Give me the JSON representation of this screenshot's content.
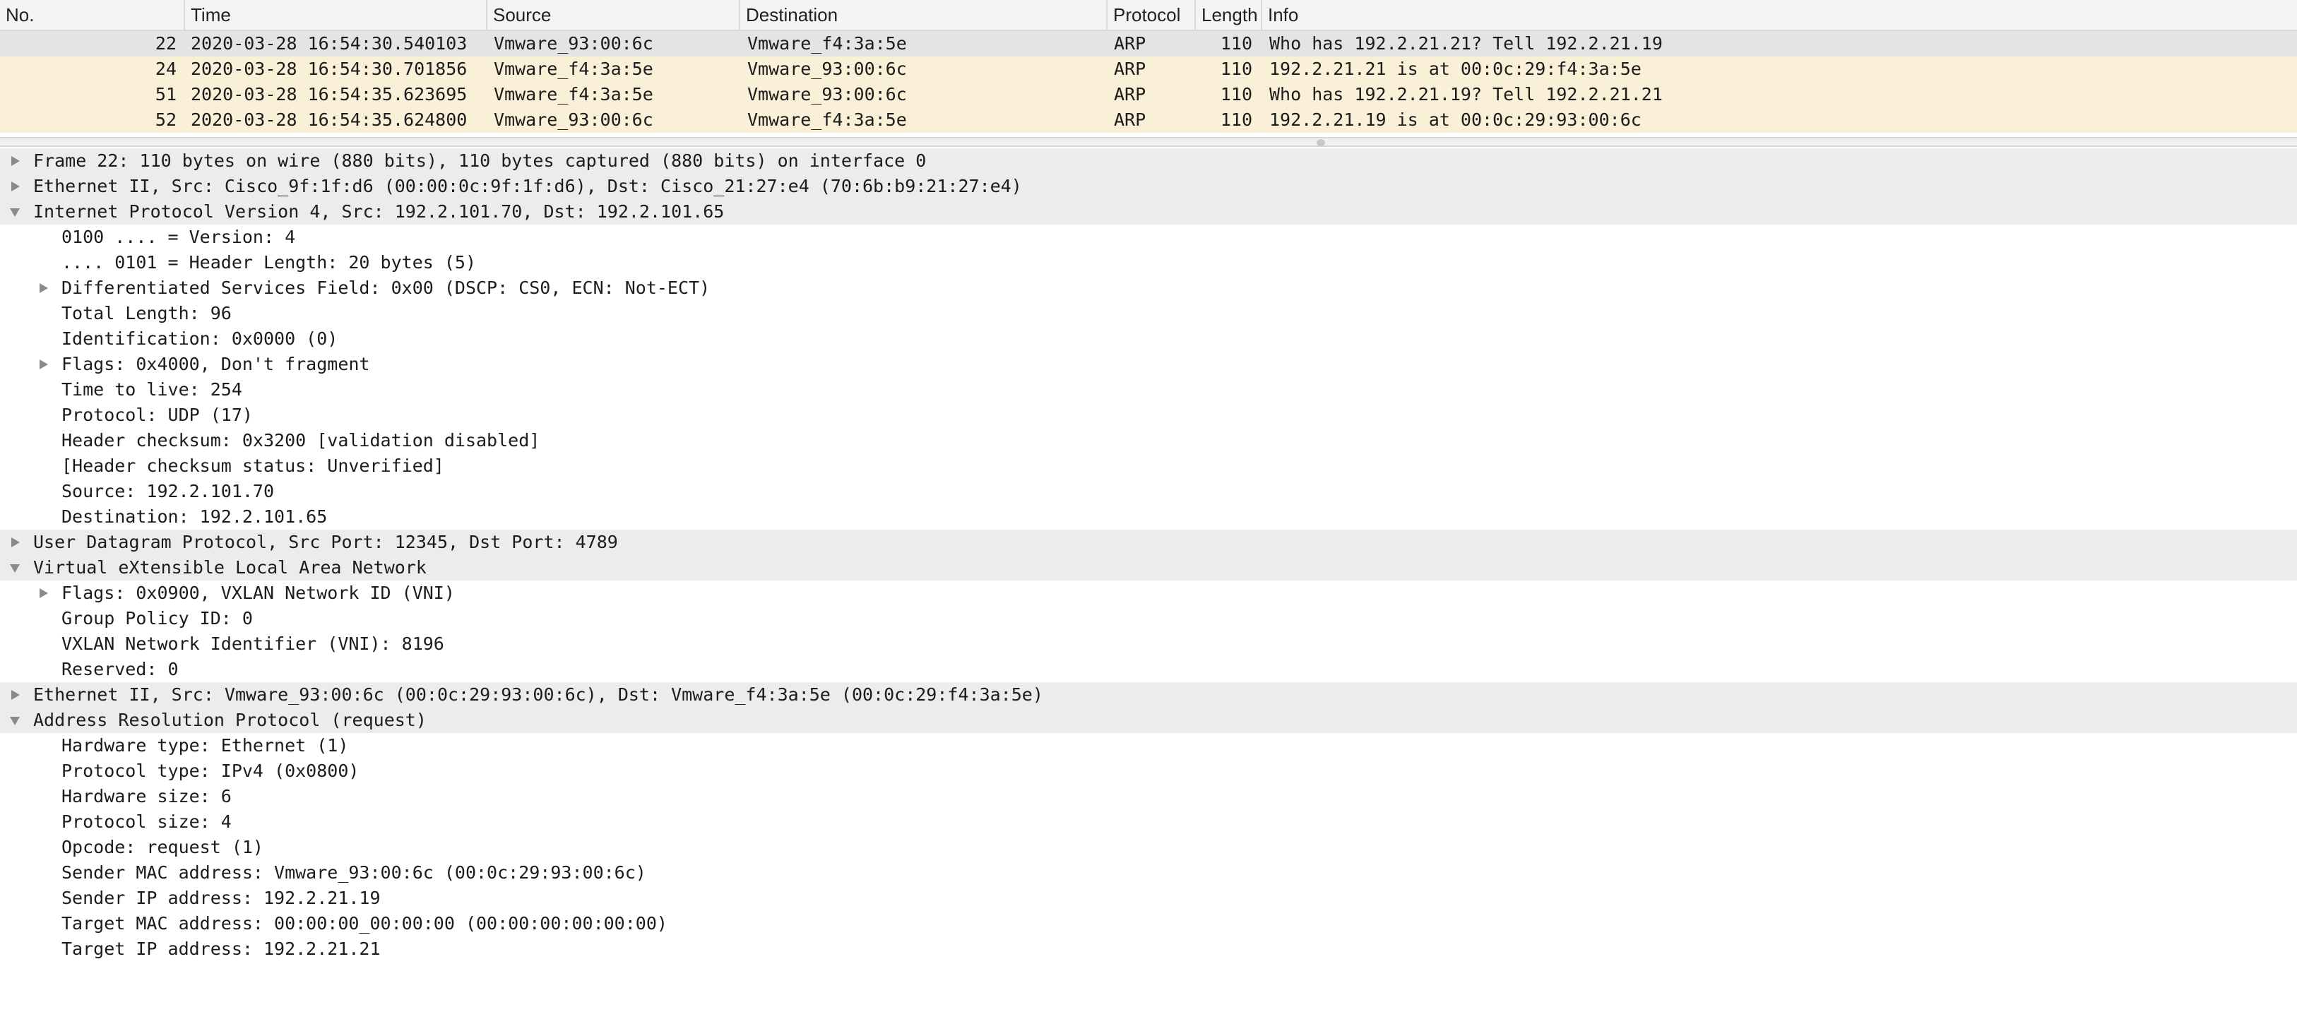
{
  "colors": {
    "selected_row": "#e4e4e4",
    "arp_row": "#faf0d7",
    "header_bg": "#f4f4f4",
    "tree_section_bg": "#ececec"
  },
  "packet_list": {
    "columns": {
      "no": "No.",
      "time": "Time",
      "source": "Source",
      "destination": "Destination",
      "protocol": "Protocol",
      "length": "Length",
      "info": "Info"
    },
    "rows": [
      {
        "no": "22",
        "time": "2020-03-28 16:54:30.540103",
        "source": "Vmware_93:00:6c",
        "destination": "Vmware_f4:3a:5e",
        "protocol": "ARP",
        "length": "110",
        "info": "Who has 192.2.21.21? Tell 192.2.21.19",
        "selected": true
      },
      {
        "no": "24",
        "time": "2020-03-28 16:54:30.701856",
        "source": "Vmware_f4:3a:5e",
        "destination": "Vmware_93:00:6c",
        "protocol": "ARP",
        "length": "110",
        "info": "192.2.21.21 is at 00:0c:29:f4:3a:5e",
        "selected": false
      },
      {
        "no": "51",
        "time": "2020-03-28 16:54:35.623695",
        "source": "Vmware_f4:3a:5e",
        "destination": "Vmware_93:00:6c",
        "protocol": "ARP",
        "length": "110",
        "info": "Who has 192.2.21.19? Tell 192.2.21.21",
        "selected": false
      },
      {
        "no": "52",
        "time": "2020-03-28 16:54:35.624800",
        "source": "Vmware_93:00:6c",
        "destination": "Vmware_f4:3a:5e",
        "protocol": "ARP",
        "length": "110",
        "info": "192.2.21.19 is at 00:0c:29:93:00:6c",
        "selected": false
      }
    ]
  },
  "packet_detail": [
    {
      "level": 0,
      "expander": "collapsed",
      "text": "Frame 22: 110 bytes on wire (880 bits), 110 bytes captured (880 bits) on interface 0"
    },
    {
      "level": 0,
      "expander": "collapsed",
      "text": "Ethernet II, Src: Cisco_9f:1f:d6 (00:00:0c:9f:1f:d6), Dst: Cisco_21:27:e4 (70:6b:b9:21:27:e4)"
    },
    {
      "level": 0,
      "expander": "expanded",
      "text": "Internet Protocol Version 4, Src: 192.2.101.70, Dst: 192.2.101.65"
    },
    {
      "level": 1,
      "expander": "none",
      "text": "0100 .... = Version: 4"
    },
    {
      "level": 1,
      "expander": "none",
      "text": ".... 0101 = Header Length: 20 bytes (5)"
    },
    {
      "level": 1,
      "expander": "collapsed",
      "text": "Differentiated Services Field: 0x00 (DSCP: CS0, ECN: Not-ECT)"
    },
    {
      "level": 1,
      "expander": "none",
      "text": "Total Length: 96"
    },
    {
      "level": 1,
      "expander": "none",
      "text": "Identification: 0x0000 (0)"
    },
    {
      "level": 1,
      "expander": "collapsed",
      "text": "Flags: 0x4000, Don't fragment"
    },
    {
      "level": 1,
      "expander": "none",
      "text": "Time to live: 254"
    },
    {
      "level": 1,
      "expander": "none",
      "text": "Protocol: UDP (17)"
    },
    {
      "level": 1,
      "expander": "none",
      "text": "Header checksum: 0x3200 [validation disabled]"
    },
    {
      "level": 1,
      "expander": "none",
      "text": "[Header checksum status: Unverified]"
    },
    {
      "level": 1,
      "expander": "none",
      "text": "Source: 192.2.101.70"
    },
    {
      "level": 1,
      "expander": "none",
      "text": "Destination: 192.2.101.65"
    },
    {
      "level": 0,
      "expander": "collapsed",
      "text": "User Datagram Protocol, Src Port: 12345, Dst Port: 4789"
    },
    {
      "level": 0,
      "expander": "expanded",
      "text": "Virtual eXtensible Local Area Network"
    },
    {
      "level": 1,
      "expander": "collapsed",
      "text": "Flags: 0x0900, VXLAN Network ID (VNI)"
    },
    {
      "level": 1,
      "expander": "none",
      "text": "Group Policy ID: 0"
    },
    {
      "level": 1,
      "expander": "none",
      "text": "VXLAN Network Identifier (VNI): 8196"
    },
    {
      "level": 1,
      "expander": "none",
      "text": "Reserved: 0"
    },
    {
      "level": 0,
      "expander": "collapsed",
      "text": "Ethernet II, Src: Vmware_93:00:6c (00:0c:29:93:00:6c), Dst: Vmware_f4:3a:5e (00:0c:29:f4:3a:5e)"
    },
    {
      "level": 0,
      "expander": "expanded",
      "text": "Address Resolution Protocol (request)"
    },
    {
      "level": 1,
      "expander": "none",
      "text": "Hardware type: Ethernet (1)"
    },
    {
      "level": 1,
      "expander": "none",
      "text": "Protocol type: IPv4 (0x0800)"
    },
    {
      "level": 1,
      "expander": "none",
      "text": "Hardware size: 6"
    },
    {
      "level": 1,
      "expander": "none",
      "text": "Protocol size: 4"
    },
    {
      "level": 1,
      "expander": "none",
      "text": "Opcode: request (1)"
    },
    {
      "level": 1,
      "expander": "none",
      "text": "Sender MAC address: Vmware_93:00:6c (00:0c:29:93:00:6c)"
    },
    {
      "level": 1,
      "expander": "none",
      "text": "Sender IP address: 192.2.21.19"
    },
    {
      "level": 1,
      "expander": "none",
      "text": "Target MAC address: 00:00:00_00:00:00 (00:00:00:00:00:00)"
    },
    {
      "level": 1,
      "expander": "none",
      "text": "Target IP address: 192.2.21.21"
    }
  ]
}
